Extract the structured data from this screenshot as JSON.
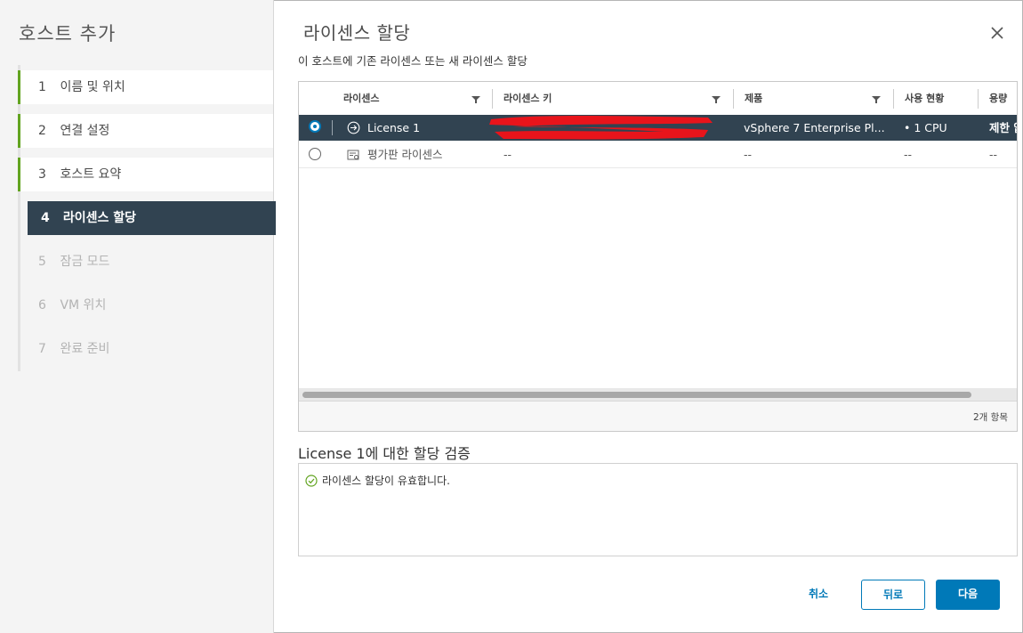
{
  "wizard": {
    "title": "호스트 추가",
    "steps": [
      {
        "num": "1",
        "label": "이름 및 위치",
        "state": "done"
      },
      {
        "num": "2",
        "label": "연결 설정",
        "state": "done"
      },
      {
        "num": "3",
        "label": "호스트 요약",
        "state": "done"
      },
      {
        "num": "4",
        "label": "라이센스 할당",
        "state": "active"
      },
      {
        "num": "5",
        "label": "잠금 모드",
        "state": "future"
      },
      {
        "num": "6",
        "label": "VM 위치",
        "state": "future"
      },
      {
        "num": "7",
        "label": "완료 준비",
        "state": "future"
      }
    ]
  },
  "page": {
    "title": "라이센스 할당",
    "subtitle": "이 호스트에 기존 라이센스 또는 새 라이센스 할당"
  },
  "grid": {
    "columns": [
      "라이센스",
      "라이센스 키",
      "제품",
      "사용 현황",
      "용량"
    ],
    "rows": [
      {
        "selected": true,
        "icon": "arrow-circle-icon",
        "license": "License 1",
        "key": "",
        "product": "vSphere 7 Enterprise Pl...",
        "usage": "• 1 CPU",
        "capacity": "제한 없"
      },
      {
        "selected": false,
        "icon": "license-icon",
        "license": "평가판 라이센스",
        "key": "--",
        "product": "--",
        "usage": "--",
        "capacity": "--"
      }
    ],
    "footer_count": "2개 항목"
  },
  "validation": {
    "title": "License 1에 대한 할당 검증",
    "message": "라이센스 할당이 유효합니다."
  },
  "buttons": {
    "cancel": "취소",
    "back": "뒤로",
    "next": "다음"
  },
  "colors": {
    "accent": "#0079b8",
    "selected_row": "#314351",
    "done_step": "#62a420",
    "success": "#62a420",
    "redaction": "#e8141b"
  }
}
